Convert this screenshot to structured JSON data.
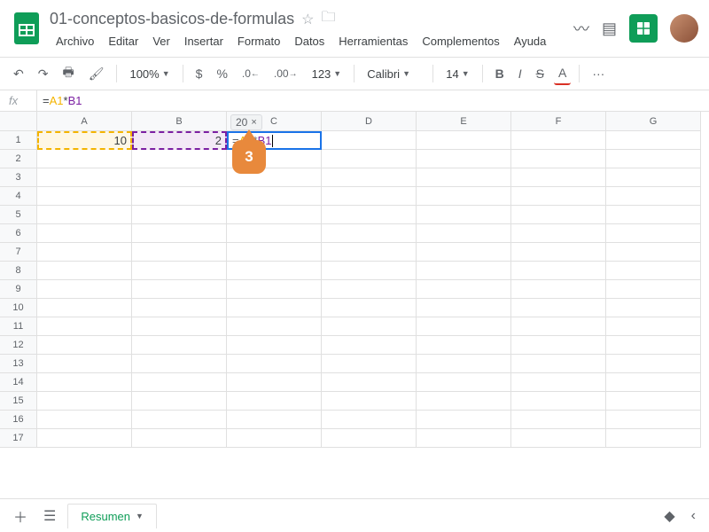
{
  "doc": {
    "title": "01-conceptos-basicos-de-formulas"
  },
  "menu": {
    "archivo": "Archivo",
    "editar": "Editar",
    "ver": "Ver",
    "insertar": "Insertar",
    "formato": "Formato",
    "datos": "Datos",
    "herramientas": "Herramientas",
    "complementos": "Complementos",
    "ayuda": "Ayuda"
  },
  "toolbar": {
    "zoom": "100%",
    "font": "Calibri",
    "size": "14",
    "dec0": ".0",
    "dec00": ".00",
    "fmt123": "123",
    "dollar": "$",
    "percent": "%",
    "bold": "B",
    "italic": "I",
    "strike": "S",
    "more": "···"
  },
  "formula": {
    "fx": "fx",
    "eq": "=",
    "ref1": "A1",
    "op": "*",
    "ref2": "B1"
  },
  "columns": [
    "A",
    "B",
    "C",
    "D",
    "E",
    "F",
    "G"
  ],
  "rows": [
    "1",
    "2",
    "3",
    "4",
    "5",
    "6",
    "7",
    "8",
    "9",
    "10",
    "11",
    "12",
    "13",
    "14",
    "15",
    "16",
    "17"
  ],
  "cells": {
    "a1": "10",
    "b1": "2",
    "c1_eq": "=",
    "c1_ref1": "A1",
    "c1_op": "*",
    "c1_ref2": "B1"
  },
  "result_tooltip": {
    "value": "20",
    "close": "×"
  },
  "callout": {
    "num": "3"
  },
  "tabs": {
    "resumen": "Resumen"
  }
}
